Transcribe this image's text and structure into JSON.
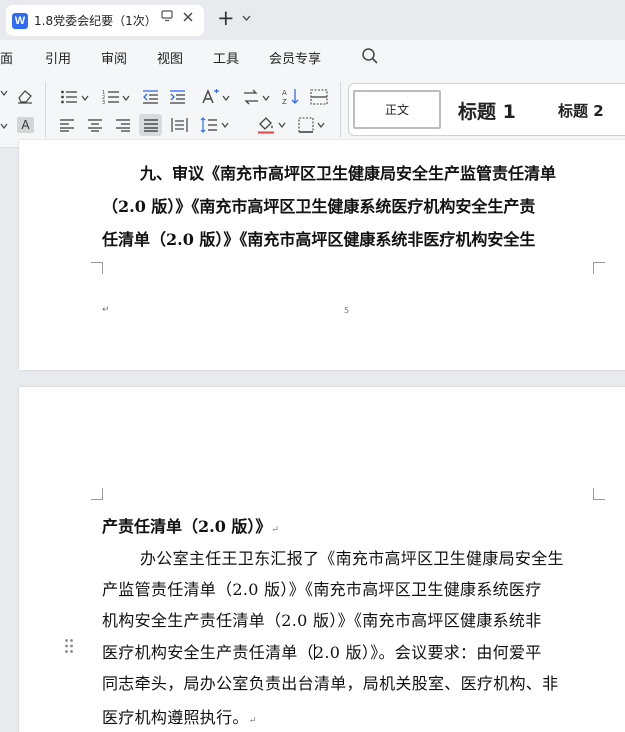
{
  "tab": {
    "logo": "W",
    "title": "1.8党委会纪要（1次）",
    "close_icon": "close-icon",
    "new_tab": "+"
  },
  "menu": {
    "items": [
      "面",
      "引用",
      "审阅",
      "视图",
      "工具",
      "会员专享"
    ]
  },
  "ribbon": {
    "font_color_label": "A",
    "styles": {
      "normal": "正文",
      "h1": "标题 1",
      "h2": "标题 2"
    }
  },
  "document": {
    "page1": {
      "lines": [
        "九、审议《南充市高坪区卫生健康局安全生产监管责任清单",
        "（2.0 版）》《南充市高坪区卫生健康系统医疗机构安全生产责",
        "任清单（2.0 版）》《南充市高坪区健康系统非医疗机构安全生"
      ],
      "page_number": "5",
      "para_mark": "↵"
    },
    "page2": {
      "heading_tail": "产责任清单（2.0 版）》",
      "para_mark": "↵",
      "body_lines": [
        "办公室主任王卫东汇报了《南充市高坪区卫生健康局安全生",
        "产监管责任清单（2.0 版）》《南充市高坪区卫生健康系统医疗",
        "机构安全生产责任清单（2.0 版）》《南充市高坪区健康系统非",
        "医疗机构安全生产责任清单（",
        "2.0 版）》。会议要求：由何爱平",
        "同志牵头，局办公室负责出台清单，局机关股室、医疗机构、非",
        "医疗机构遵照执行。"
      ]
    }
  },
  "colors": {
    "accent": "#2f6bf5",
    "page_bg": "#ffffff",
    "canvas_bg": "#e9eaee"
  }
}
